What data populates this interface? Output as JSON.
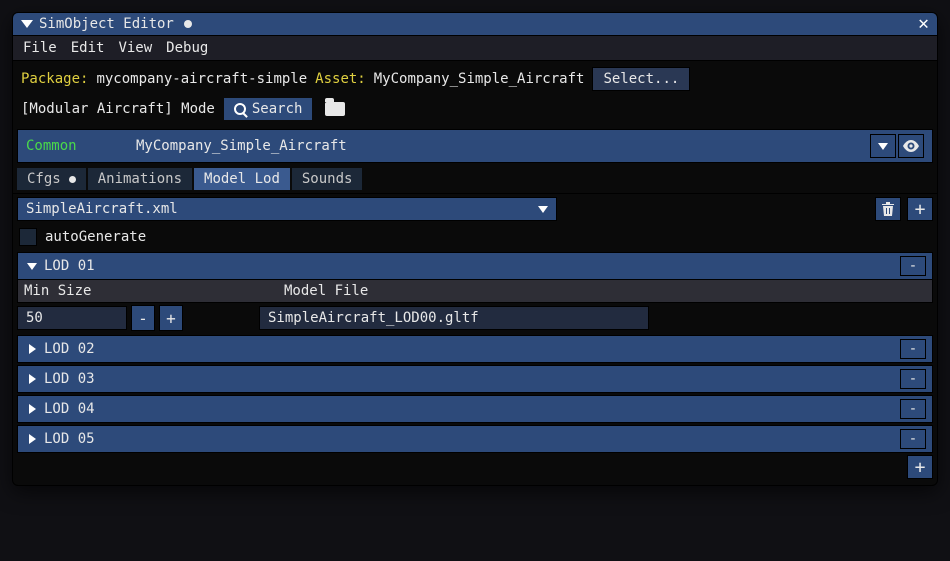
{
  "window": {
    "title": "SimObject Editor",
    "modified": true
  },
  "menu": {
    "file": "File",
    "edit": "Edit",
    "view": "View",
    "debug": "Debug"
  },
  "info": {
    "package_label": "Package:",
    "package_value": "mycompany-aircraft-simple",
    "asset_label": "Asset:",
    "asset_value": "MyCompany_Simple_Aircraft",
    "select_label": "Select...",
    "mode_label": "[Modular Aircraft] Mode",
    "search_label": "Search"
  },
  "common": {
    "label": "Common",
    "asset_name": "MyCompany_Simple_Aircraft"
  },
  "tabs": {
    "cfgs": "Cfgs",
    "animations": "Animations",
    "model_lod": "Model Lod",
    "sounds": "Sounds"
  },
  "file_dropdown": {
    "value": "SimpleAircraft.xml"
  },
  "autogen": {
    "label": "autoGenerate",
    "checked": false
  },
  "lod_expanded": {
    "name": "LOD 01",
    "col_min_size": "Min Size",
    "col_model_file": "Model File",
    "min_size_value": "50",
    "model_file_value": "SimpleAircraft_LOD00.gltf"
  },
  "lods_collapsed": [
    {
      "name": "LOD 02"
    },
    {
      "name": "LOD 03"
    },
    {
      "name": "LOD 04"
    },
    {
      "name": "LOD 05"
    }
  ],
  "glyphs": {
    "minus": "-",
    "plus": "+"
  }
}
